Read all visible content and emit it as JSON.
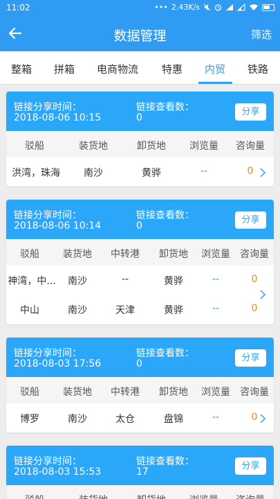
{
  "status_bar": {
    "time": "11:02",
    "speed": "2.43K/s",
    "dots": "•••"
  },
  "header": {
    "title": "数据管理",
    "filter_label": "筛选"
  },
  "tabs": [
    {
      "label": "整箱"
    },
    {
      "label": "拼箱"
    },
    {
      "label": "电商物流"
    },
    {
      "label": "特惠"
    },
    {
      "label": "内贸"
    },
    {
      "label": "铁路"
    }
  ],
  "active_tab": "内贸",
  "labels": {
    "share_time": "链接分享时间：",
    "view_count": "链接查看数：",
    "share_button": "分享"
  },
  "cards": [
    {
      "share_time": "2018-08-06 10:15",
      "view_count": "0",
      "columns": [
        "驳船",
        "装货地",
        "卸货地",
        "浏览量",
        "咨询量"
      ],
      "rows": [
        [
          "洪湾，珠海",
          "南沙",
          "黄骅",
          "--",
          "0"
        ]
      ]
    },
    {
      "share_time": "2018-08-06 10:14",
      "view_count": "0",
      "columns": [
        "驳船",
        "装货地",
        "中转港",
        "卸货地",
        "浏览量",
        "咨询量"
      ],
      "rows": [
        [
          "神湾，中...",
          "南沙",
          "--",
          "黄骅",
          "--",
          "0"
        ],
        [
          "中山",
          "南沙",
          "天津",
          "黄骅",
          "--",
          "0"
        ]
      ]
    },
    {
      "share_time": "2018-08-03 17:56",
      "view_count": "0",
      "columns": [
        "驳船",
        "装货地",
        "中转港",
        "卸货地",
        "浏览量",
        "咨询量"
      ],
      "rows": [
        [
          "博罗",
          "南沙",
          "太仓",
          "盘锦",
          "--",
          "0"
        ]
      ]
    },
    {
      "share_time": "2018-08-03 15:53",
      "view_count": "17",
      "columns": [
        "驳船",
        "装货地",
        "卸货地",
        "浏览量",
        "咨询量"
      ],
      "rows": []
    }
  ],
  "colors": {
    "primary": "#2f9bf3",
    "card_header": "#2aa7f9",
    "count": "#f0871a"
  }
}
